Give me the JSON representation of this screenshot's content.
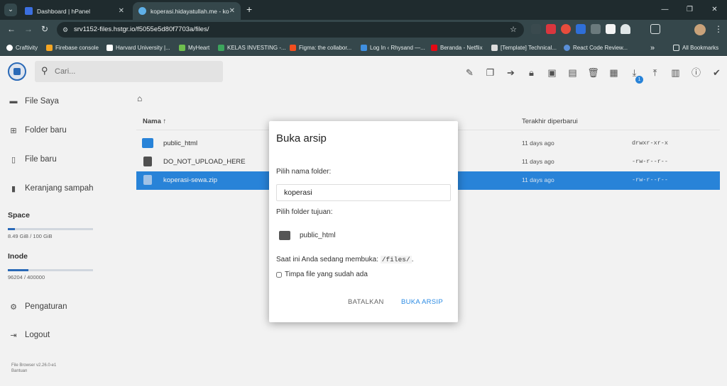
{
  "browser": {
    "tabs": [
      {
        "title": "Dashboard | hPanel",
        "active": false
      },
      {
        "title": "koperasi.hidayatullah.me - kope",
        "active": true
      }
    ],
    "url": "srv1152-files.hstgr.io/f5055e5d80f7703a/files/",
    "bookmarks": [
      "Craftivity",
      "Firebase console",
      "Harvard University |...",
      "MyHeart",
      "KELAS INVESTING -...",
      "Figma: the collabor...",
      "Log In ‹ Rhysand —...",
      "Beranda - Netflix",
      "[Template] Technical...",
      "React Code Review..."
    ],
    "bookmarks_more": "»",
    "all_bookmarks": "All Bookmarks"
  },
  "app": {
    "search_placeholder": "Cari...",
    "toolbar_icons": [
      "edit-icon",
      "copy-icon",
      "move-icon",
      "lock-icon",
      "archive-icon",
      "unarchive-icon",
      "delete-icon",
      "grid-view-icon",
      "download-icon",
      "upload-icon",
      "info-chart-icon",
      "info-icon",
      "check-icon"
    ],
    "download_badge": "1"
  },
  "sidebar": {
    "items": [
      {
        "label": "File Saya",
        "icon": "folder-icon"
      },
      {
        "label": "Folder baru",
        "icon": "new-folder-icon"
      },
      {
        "label": "File baru",
        "icon": "new-file-icon"
      },
      {
        "label": "Keranjang sampah",
        "icon": "trash-icon"
      }
    ],
    "space": {
      "label": "Space",
      "value": "8.49 GiB / 100 GiB",
      "fraction": 0.085
    },
    "inode": {
      "label": "Inode",
      "value": "96204 / 400000",
      "fraction": 0.24
    },
    "bottom_items": [
      {
        "label": "Pengaturan",
        "icon": "settings-icon"
      },
      {
        "label": "Logout",
        "icon": "logout-icon"
      }
    ],
    "footer": [
      "File Browser v2.26.0-e1",
      "Bantuan"
    ]
  },
  "listing": {
    "breadcrumb_icon": "home-icon",
    "columns": {
      "name": "Nama",
      "modified": "Terakhir diperbarui"
    },
    "rows": [
      {
        "name": "public_html",
        "modified": "11 days ago",
        "perm": "drwxr-xr-x",
        "type": "folder",
        "selected": false
      },
      {
        "name": "DO_NOT_UPLOAD_HERE",
        "modified": "11 days ago",
        "perm": "-rw-r--r--",
        "type": "file",
        "selected": false
      },
      {
        "name": "koperasi-sewa.zip",
        "modified": "11 days ago",
        "perm": "-rw-r--r--",
        "type": "archive",
        "selected": true
      }
    ]
  },
  "dialog": {
    "title": "Buka arsip",
    "folder_name_label": "Pilih nama folder:",
    "folder_name_value": "koperasi",
    "dest_label": "Pilih folder tujuan:",
    "dest_folder": "public_html",
    "current_prefix": "Saat ini Anda sedang membuka: ",
    "current_path": "/files/",
    "current_suffix": ".",
    "overwrite_label": "Timpa file yang sudah ada",
    "cancel_label": "BATALKAN",
    "ok_label": "BUKA ARSIP"
  }
}
